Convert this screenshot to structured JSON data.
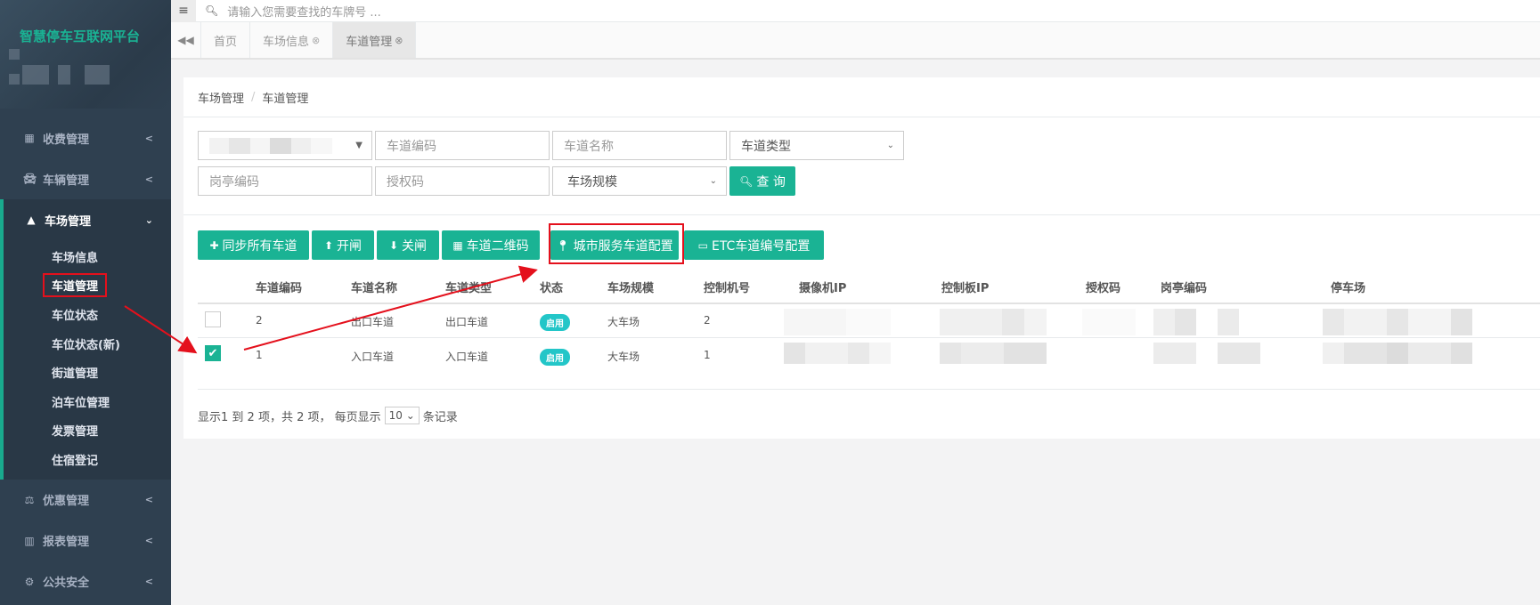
{
  "app": {
    "brand": "智慧停车互联网平台"
  },
  "topbar": {
    "search_placeholder": "请输入您需要查找的车牌号 ..."
  },
  "sidebar": {
    "items": [
      {
        "label": "收费管理",
        "icon": "grid-icon"
      },
      {
        "label": "车辆管理",
        "icon": "car-icon"
      },
      {
        "label": "车场管理",
        "icon": "road-icon",
        "expanded": true
      },
      {
        "label": "优惠管理",
        "icon": "balance-icon"
      },
      {
        "label": "报表管理",
        "icon": "bar-chart-icon"
      },
      {
        "label": "公共安全",
        "icon": "gears-icon"
      }
    ],
    "subitems": [
      "车场信息",
      "车道管理",
      "车位状态",
      "车位状态(新)",
      "街道管理",
      "泊车位管理",
      "发票管理",
      "住宿登记"
    ]
  },
  "tabs": {
    "items": [
      {
        "label": "首页",
        "closable": false
      },
      {
        "label": "车场信息",
        "closable": true
      },
      {
        "label": "车道管理",
        "closable": true,
        "active": true
      }
    ]
  },
  "breadcrumb": {
    "parent": "车场管理",
    "current": "车道管理"
  },
  "filters": {
    "lane_code_placeholder": "车道编码",
    "lane_name_placeholder": "车道名称",
    "lane_type_select": "车道类型",
    "booth_code_placeholder": "岗亭编码",
    "auth_code_placeholder": "授权码",
    "scale_select": "车场规模",
    "query_button": "查 询"
  },
  "toolbar": {
    "sync_all": "同步所有车道",
    "open_gate": "开闸",
    "close_gate": "关闸",
    "qr_code": "车道二维码",
    "city_service": "城市服务车道配置",
    "etc_config": "ETC车道编号配置"
  },
  "table": {
    "headers": [
      "车道编码",
      "车道名称",
      "车道类型",
      "状态",
      "车场规模",
      "控制机号",
      "摄像机IP",
      "控制板IP",
      "授权码",
      "岗亭编码",
      "停车场"
    ],
    "rows": [
      {
        "code": "2",
        "name": "出口车道",
        "type": "出口车道",
        "status": "启用",
        "scale": "大车场",
        "controller": "2",
        "checked": false
      },
      {
        "code": "1",
        "name": "入口车道",
        "type": "入口车道",
        "status": "启用",
        "scale": "大车场",
        "controller": "1",
        "checked": true
      }
    ]
  },
  "pagination": {
    "prefix": "显示1 到 2 项，共 2 项， 每页显示",
    "page_size": "10",
    "suffix": "条记录"
  },
  "colors": {
    "accent": "#1ab394",
    "sidebar": "#2f4050",
    "badge": "#23c6c8",
    "annotation": "#e4101c"
  }
}
